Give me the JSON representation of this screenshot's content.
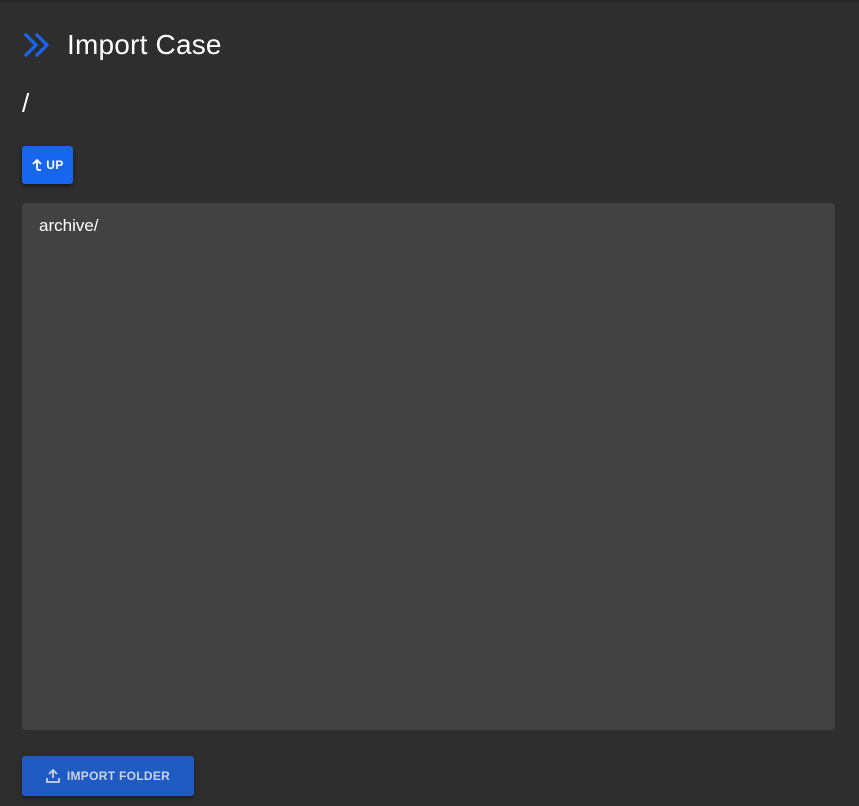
{
  "colors": {
    "background": "#2e2e2e",
    "panel": "#424242",
    "accent": "#1766f0",
    "import_button": "#1f5bc2"
  },
  "header": {
    "icon": "double-chevron-right-icon",
    "title": "Import Case"
  },
  "current_path": "/",
  "up_button": {
    "icon": "arrow-up-return-icon",
    "label": "UP"
  },
  "listing": {
    "items": [
      {
        "label": "archive/"
      }
    ]
  },
  "import_button": {
    "icon": "upload-icon",
    "label": "IMPORT FOLDER"
  }
}
